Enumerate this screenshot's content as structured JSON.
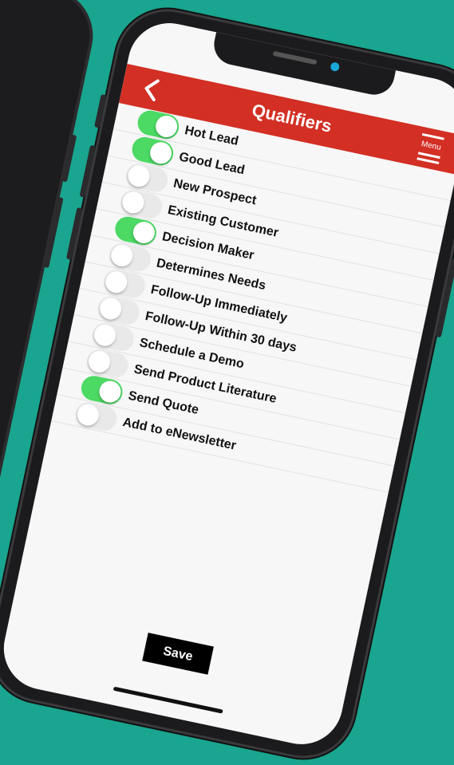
{
  "header": {
    "title": "Qualifiers",
    "back_icon": "chevron-left-icon",
    "menu_label": "Menu",
    "menu_icon": "hamburger-icon"
  },
  "qualifiers": [
    {
      "label": "Hot Lead",
      "on": true
    },
    {
      "label": "Good Lead",
      "on": true
    },
    {
      "label": "New Prospect",
      "on": false
    },
    {
      "label": "Existing Customer",
      "on": false
    },
    {
      "label": "Decision Maker",
      "on": true
    },
    {
      "label": "Determines Needs",
      "on": false
    },
    {
      "label": "Follow-Up Immediately",
      "on": false
    },
    {
      "label": "Follow-Up Within 30 days",
      "on": false
    },
    {
      "label": "Schedule a Demo",
      "on": false
    },
    {
      "label": "Send Product Literature",
      "on": false
    },
    {
      "label": "Send Quote",
      "on": true
    },
    {
      "label": "Add to eNewsletter",
      "on": false
    }
  ],
  "footer": {
    "save_label": "Save"
  },
  "colors": {
    "background": "#19a58f",
    "header": "#d32f24",
    "toggle_on": "#4cd964",
    "toggle_off": "#e9e9ea",
    "camera": "#1aa7d8"
  }
}
